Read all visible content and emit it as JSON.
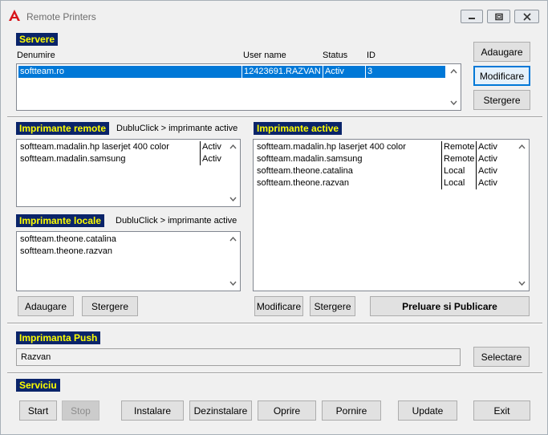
{
  "window": {
    "title": "Remote Printers"
  },
  "servere": {
    "title": "Servere",
    "columns": {
      "denumire": "Denumire",
      "user": "User name",
      "status": "Status",
      "id": "ID"
    },
    "rows": [
      {
        "denumire": "softteam.ro",
        "user": "12423691.RAZVAN",
        "status": "Activ",
        "id": "3"
      }
    ],
    "buttons": {
      "add": "Adaugare",
      "modify": "Modificare",
      "delete": "Stergere"
    }
  },
  "remote": {
    "title": "Imprimante remote",
    "hint": "DubluClick > imprimante active",
    "rows": [
      {
        "name": "softteam.madalin.hp laserjet 400 color",
        "status": "Activ"
      },
      {
        "name": "softteam.madalin.samsung",
        "status": "Activ"
      }
    ]
  },
  "locale": {
    "title": "Imprimante locale",
    "hint": "DubluClick >  imprimante active",
    "rows": [
      {
        "name": "softteam.theone.catalina"
      },
      {
        "name": "softteam.theone.razvan"
      }
    ],
    "buttons": {
      "add": "Adaugare",
      "delete": "Stergere"
    }
  },
  "active": {
    "title": "Imprimante active",
    "rows": [
      {
        "name": "softteam.madalin.hp laserjet 400 color",
        "type": "Remote",
        "status": "Activ"
      },
      {
        "name": "softteam.madalin.samsung",
        "type": "Remote",
        "status": "Activ"
      },
      {
        "name": "softteam.theone.catalina",
        "type": "Local",
        "status": "Activ"
      },
      {
        "name": "softteam.theone.razvan",
        "type": "Local",
        "status": "Activ"
      }
    ],
    "buttons": {
      "modify": "Modificare",
      "delete": "Stergere",
      "publish": "Preluare si Publicare"
    }
  },
  "push": {
    "title": "Imprimanta Push",
    "value": "Razvan",
    "select_label": "Selectare"
  },
  "serviciu": {
    "title": "Serviciu",
    "buttons": {
      "start": "Start",
      "stop": "Stop",
      "install": "Instalare",
      "uninstall": "Dezinstalare",
      "oprire": "Oprire",
      "pornire": "Pornire",
      "update": "Update",
      "exit": "Exit"
    }
  }
}
